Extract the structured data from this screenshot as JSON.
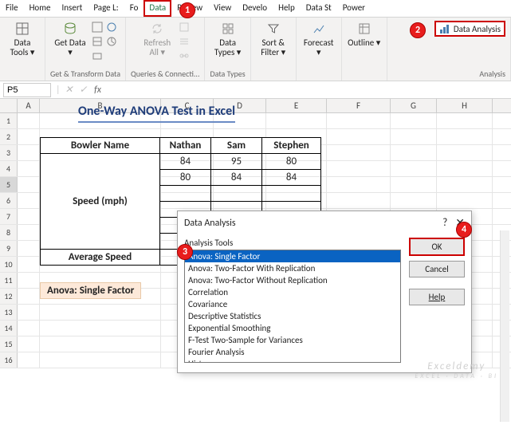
{
  "tabs": [
    "File",
    "Home",
    "Insert",
    "Page L:",
    "Fo",
    "Data",
    "Review",
    "View",
    "Develo",
    "Help",
    "Data St",
    "Power"
  ],
  "active_tab_index": 5,
  "ribbon": {
    "data_tools": {
      "label": "Data Tools ▾"
    },
    "get_data": {
      "label": "Get Data ▾"
    },
    "group_transform": "Get & Transform Data",
    "refresh": {
      "label": "Refresh All ▾"
    },
    "group_queries": "Queries & Connecti...",
    "data_types_btn": {
      "label": "Data Types ▾"
    },
    "group_types": "Data Types",
    "sort_filter": {
      "label": "Sort & Filter ▾"
    },
    "forecast": {
      "label": "Forecast ▾"
    },
    "outline": {
      "label": "Outline ▾"
    },
    "data_analysis": "Data Analysis",
    "group_analysis": "Analysis"
  },
  "namebox": "P5",
  "formula": "",
  "cols": [
    "A",
    "B",
    "C",
    "D",
    "E",
    "F",
    "G",
    "H"
  ],
  "chart_data": {
    "type": "table",
    "title": "One-Way ANOVA Test in Excel",
    "row_label": "Bowler Name",
    "side_label": "Speed (mph)",
    "avg_label": "Average Speed",
    "columns": [
      "Nathan",
      "Sam",
      "Stephen"
    ],
    "rows": [
      [
        84,
        95,
        80
      ],
      [
        80,
        84,
        84
      ],
      [
        null,
        null,
        null
      ],
      [
        null,
        null,
        null
      ],
      [
        null,
        null,
        null
      ],
      [
        null,
        null,
        null
      ]
    ],
    "averages": [
      null,
      null,
      null
    ]
  },
  "note": "Anova: Single Factor",
  "dialog": {
    "title": "Data Analysis",
    "tools_label": "Analysis Tools",
    "items": [
      "Anova: Single Factor",
      "Anova: Two-Factor With Replication",
      "Anova: Two-Factor Without Replication",
      "Correlation",
      "Covariance",
      "Descriptive Statistics",
      "Exponential Smoothing",
      "F-Test Two-Sample for Variances",
      "Fourier Analysis",
      "Histogram"
    ],
    "selected_index": 0,
    "ok": "OK",
    "cancel": "Cancel",
    "help": "Help"
  },
  "callouts": {
    "c1": "1",
    "c2": "2",
    "c3": "3",
    "c4": "4"
  },
  "watermark": {
    "main": "Exceldemy",
    "sub": "EXCEL · DATA · BI"
  }
}
